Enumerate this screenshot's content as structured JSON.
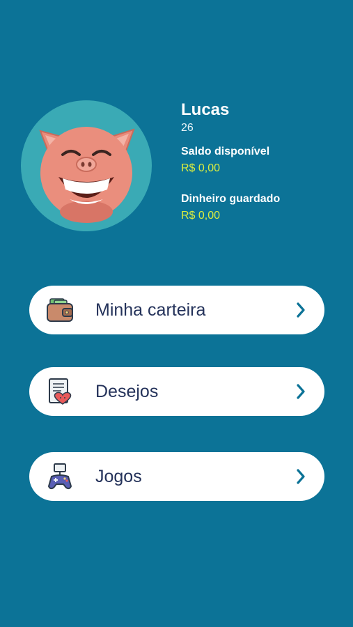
{
  "profile": {
    "name": "Lucas",
    "age": "26",
    "available_balance_label": "Saldo disponível",
    "available_balance_value": "R$ 0,00",
    "saved_money_label": "Dinheiro guardado",
    "saved_money_value": "R$ 0,00",
    "avatar_icon": "pig-avatar-icon"
  },
  "menu": [
    {
      "label": "Minha carteira",
      "icon": "wallet-icon"
    },
    {
      "label": "Desejos",
      "icon": "wishlist-icon"
    },
    {
      "label": "Jogos",
      "icon": "gamepad-icon"
    }
  ],
  "colors": {
    "background": "#0c7397",
    "avatar_circle": "#3aaab5",
    "money": "#d9ec3f",
    "button_text": "#24325a",
    "chevron": "#0c7397"
  }
}
